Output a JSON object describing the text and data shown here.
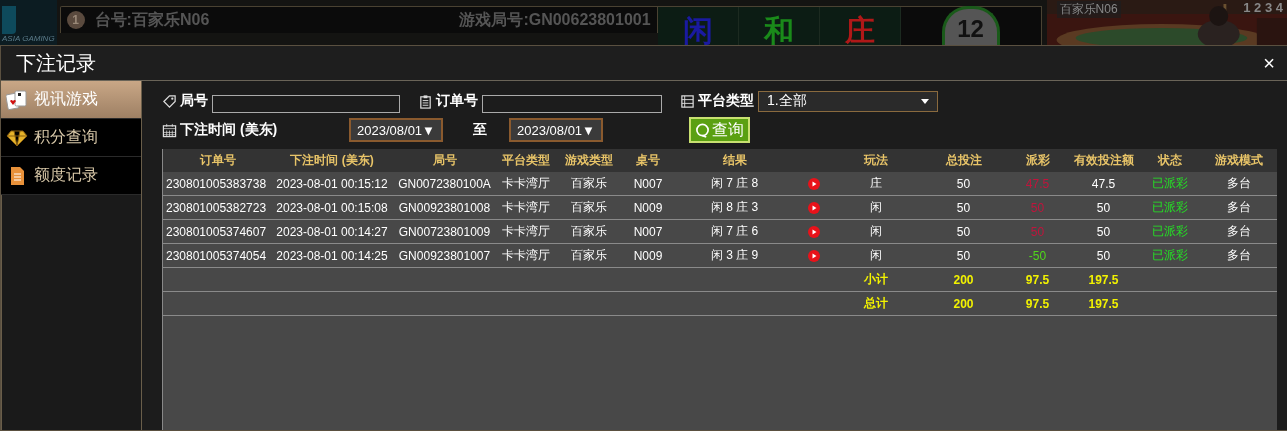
{
  "background": {
    "logo_text": "ASIA GAMING",
    "table_badge": "1",
    "table_name": "台号:百家乐N06",
    "round_id": "游戏局号:GN00623801001",
    "bet_labels": [
      {
        "text": "闲",
        "color": "#1a1aa0"
      },
      {
        "text": "和",
        "color": "#1a8a1a"
      },
      {
        "text": "庄",
        "color": "#b01818"
      }
    ],
    "countdown": "12",
    "video_label": "百家乐N06",
    "road_numbers": "1 2 3 4"
  },
  "dialog": {
    "title": "下注记录",
    "close": "×"
  },
  "sidebar": {
    "items": [
      {
        "label": "视讯游戏",
        "kind": "cards",
        "selected": true
      },
      {
        "label": "积分查询",
        "kind": "diamond",
        "selected": false
      },
      {
        "label": "额度记录",
        "kind": "document",
        "selected": false
      }
    ]
  },
  "filters": {
    "round_label": "局号",
    "order_label": "订单号",
    "platform_label": "平台类型",
    "platform_value": "1.全部",
    "time_label": "下注时间 (美东)",
    "date_from": "2023/08/01▼",
    "to_label": "至",
    "date_to": "2023/08/01▼",
    "query_button": "查询"
  },
  "table": {
    "columns": [
      "订单号",
      "下注时间 (美东)",
      "局号",
      "平台类型",
      "游戏类型",
      "桌号",
      "结果",
      "玩法",
      "总投注",
      "派彩",
      "有效投注额",
      "状态",
      "游戏模式"
    ],
    "rows": [
      {
        "order": "230801005383738",
        "time": "2023-08-01 00:15:12",
        "round": "GN0072380100A",
        "platform": "卡卡湾厅",
        "game": "百家乐",
        "table": "N007",
        "result": "闲 7 庄 8",
        "bet": "庄",
        "total": "50",
        "payout": {
          "text": "47.5",
          "color": "#c0143c"
        },
        "valid": "47.5",
        "status": "已派彩",
        "mode": "多台"
      },
      {
        "order": "230801005382723",
        "time": "2023-08-01 00:15:08",
        "round": "GN00923801008",
        "platform": "卡卡湾厅",
        "game": "百家乐",
        "table": "N009",
        "result": "闲 8 庄 3",
        "bet": "闲",
        "total": "50",
        "payout": {
          "text": "50",
          "color": "#c0143c"
        },
        "valid": "50",
        "status": "已派彩",
        "mode": "多台"
      },
      {
        "order": "230801005374607",
        "time": "2023-08-01 00:14:27",
        "round": "GN00723801009",
        "platform": "卡卡湾厅",
        "game": "百家乐",
        "table": "N007",
        "result": "闲 7 庄 6",
        "bet": "闲",
        "total": "50",
        "payout": {
          "text": "50",
          "color": "#c0143c"
        },
        "valid": "50",
        "status": "已派彩",
        "mode": "多台"
      },
      {
        "order": "230801005374054",
        "time": "2023-08-01 00:14:25",
        "round": "GN00923801007",
        "platform": "卡卡湾厅",
        "game": "百家乐",
        "table": "N009",
        "result": "闲 3 庄 9",
        "bet": "闲",
        "total": "50",
        "payout": {
          "text": "-50",
          "color": "#4fd81a"
        },
        "valid": "50",
        "status": "已派彩",
        "mode": "多台"
      }
    ],
    "summaries": [
      {
        "label": "小计",
        "total": "200",
        "payout": "97.5",
        "valid": "197.5"
      },
      {
        "label": "总计",
        "total": "200",
        "payout": "97.5",
        "valid": "197.5"
      }
    ]
  }
}
